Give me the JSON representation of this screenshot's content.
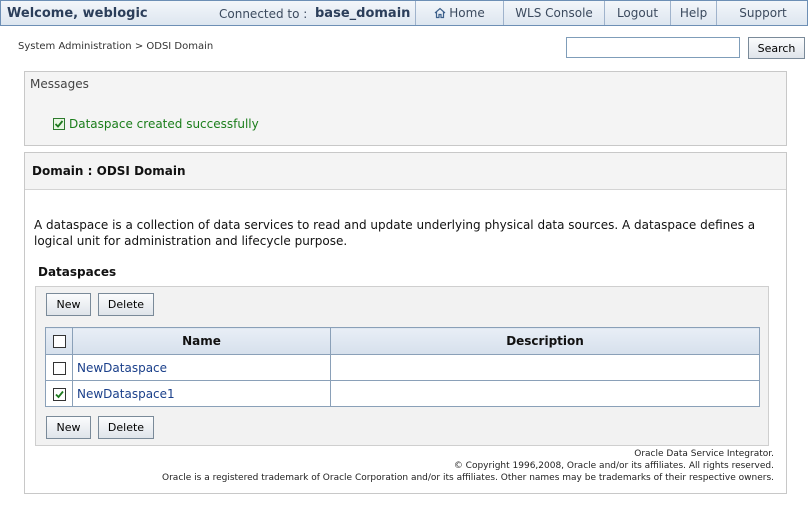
{
  "topbar": {
    "welcome": "Welcome, weblogic",
    "connected_label": "Connected to :",
    "domain": "base_domain",
    "nav": [
      "Home",
      "WLS Console",
      "Logout",
      "Help",
      "Support"
    ]
  },
  "breadcrumb": "System Administration > ODSI Domain",
  "search": {
    "value": "",
    "button": "Search"
  },
  "messages": {
    "title": "Messages",
    "success": "Dataspace created successfully"
  },
  "domain_panel": {
    "title": "Domain : ODSI Domain",
    "description": "A dataspace is a collection of data services to read and update underlying physical data sources. A dataspace defines a logical unit for administration and lifecycle purpose.",
    "section": "Dataspaces",
    "new_label": "New",
    "delete_label": "Delete",
    "columns": [
      "Name",
      "Description"
    ],
    "rows": [
      {
        "name": "NewDataspace",
        "description": "",
        "checked": false
      },
      {
        "name": "NewDataspace1",
        "description": "",
        "checked": true
      }
    ]
  },
  "footer": {
    "line1": "Oracle Data Service Integrator.",
    "line2": "© Copyright 1996,2008, Oracle and/or its affiliates. All rights reserved.",
    "line3": "Oracle is a registered trademark of Oracle Corporation and/or its affiliates. Other names may be trademarks of their respective owners."
  }
}
